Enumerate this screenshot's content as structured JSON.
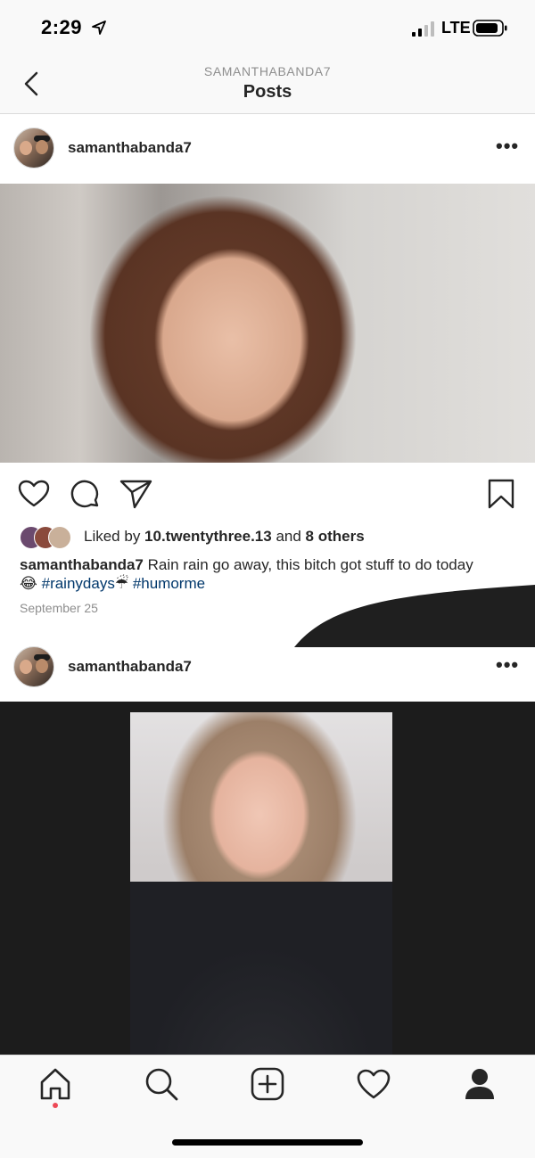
{
  "status_bar": {
    "time": "2:29",
    "network": "LTE"
  },
  "header": {
    "subtitle": "SAMANTHABANDA7",
    "title": "Posts"
  },
  "posts": [
    {
      "username": "samanthabanda7",
      "liked_by_prefix": "Liked by ",
      "liked_by_user": "10.twentythree.13",
      "liked_by_middle": " and ",
      "liked_by_others": "8 others",
      "caption_user": "samanthabanda7",
      "caption_text": " Rain rain go away, this bitch got stuff to do today",
      "caption_emoji": "😂",
      "hashtag_1": "#rainydays",
      "caption_emoji_2": "☔",
      "hashtag_2": "#humorme",
      "date": "September 25"
    },
    {
      "username": "samanthabanda7"
    }
  ],
  "icons": {
    "back": "chevron-left-icon",
    "more": "more-icon",
    "like": "heart-icon",
    "comment": "comment-icon",
    "share": "send-icon",
    "save": "bookmark-icon",
    "tabs": [
      "home-icon",
      "search-icon",
      "add-icon",
      "activity-heart-icon",
      "profile-icon"
    ]
  },
  "colors": {
    "hashtag": "#00376b",
    "notification_dot": "#ed4956"
  }
}
